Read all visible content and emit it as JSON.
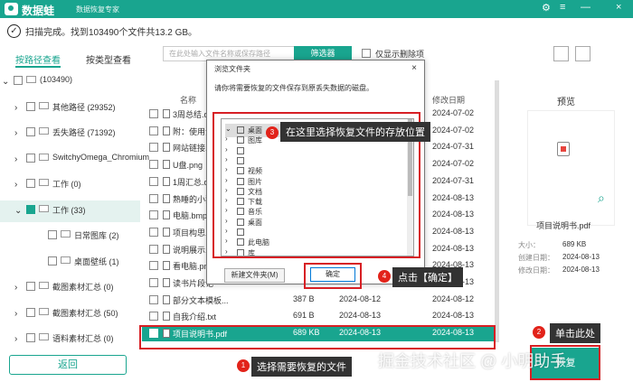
{
  "app": {
    "brand": "数据蛙",
    "subtitle": "数据恢复专家"
  },
  "status": "扫描完成。找到103490个文件共13.2 GB。",
  "search": {
    "placeholder": "在此处输入文件名称或保存路径",
    "filter": "筛选器",
    "only_deleted": "仅显示删除项"
  },
  "tabs": [
    "按路径查看",
    "按类型查看"
  ],
  "tree": [
    {
      "label": "(103490)",
      "level": 0,
      "checked": false
    },
    {
      "label": "其他路径 (29352)",
      "level": 1,
      "checked": false
    },
    {
      "label": "丢失路径 (71392)",
      "level": 1,
      "checked": false
    },
    {
      "label": "SwitchyOmega_Chromium",
      "level": 1,
      "checked": false
    },
    {
      "label": "工作 (0)",
      "level": 1,
      "checked": false
    },
    {
      "label": "工作 (33)",
      "level": 1,
      "checked": true
    },
    {
      "label": "日常图库 (2)",
      "level": 2,
      "checked": false
    },
    {
      "label": "桌面壁纸 (1)",
      "level": 2,
      "checked": false
    },
    {
      "label": "截图素材汇总 (0)",
      "level": 1,
      "checked": false
    },
    {
      "label": "截图素材汇总 (50)",
      "level": 1,
      "checked": false
    },
    {
      "label": "语料素材汇总 (0)",
      "level": 1,
      "checked": false
    }
  ],
  "back": "返回",
  "columns": {
    "name": "名称",
    "modified": "修改日期"
  },
  "files": [
    {
      "name": "3周总结.do",
      "size": "",
      "date": "",
      "modified": "2024-07-02",
      "checked": false
    },
    {
      "name": "附：使用注",
      "size": "",
      "date": "",
      "modified": "2024-07-02",
      "checked": false
    },
    {
      "name": "网站链接.tx",
      "size": "",
      "date": "",
      "modified": "2024-07-31",
      "checked": false
    },
    {
      "name": "U盘.png",
      "size": "",
      "date": "",
      "modified": "2024-07-02",
      "checked": false
    },
    {
      "name": "1周汇总.do",
      "size": "",
      "date": "",
      "modified": "2024-07-31",
      "checked": false
    },
    {
      "name": "熟睡的小猫",
      "size": "",
      "date": "",
      "modified": "2024-08-13",
      "checked": false
    },
    {
      "name": "电脑.bmp",
      "size": "",
      "date": "",
      "modified": "2024-08-13",
      "checked": false
    },
    {
      "name": "项目构思.do",
      "size": "",
      "date": "",
      "modified": "2024-08-13",
      "checked": false
    },
    {
      "name": "说明展示.pn",
      "size": "",
      "date": "",
      "modified": "2024-08-13",
      "checked": false
    },
    {
      "name": "看电脑.png",
      "size": "",
      "date": "",
      "modified": "2024-08-13",
      "checked": false
    },
    {
      "name": "读书片段记",
      "size": "",
      "date": "",
      "modified": "2024-08-13",
      "checked": false
    },
    {
      "name": "部分文本模板...",
      "size": "387 B",
      "date": "2024-08-12",
      "modified": "2024-08-12",
      "checked": false
    },
    {
      "name": "自我介绍.txt",
      "size": "691 B",
      "date": "2024-08-13",
      "modified": "2024-08-13",
      "checked": false
    },
    {
      "name": "项目说明书.pdf",
      "size": "689 KB",
      "date": "2024-08-13",
      "modified": "2024-08-13",
      "checked": true
    }
  ],
  "preview": {
    "title": "预览",
    "name": "项目说明书.pdf",
    "size_label": "大小：",
    "size": "689 KB",
    "created_label": "创建日期：",
    "created": "2024-08-13",
    "modified_label": "修改日期：",
    "modified": "2024-08-13"
  },
  "restore": "恢复",
  "dialog": {
    "title": "浏览文件夹",
    "prompt": "请你将需要恢复的文件保存到原丢失数据的磁盘。",
    "new_folder": "新建文件夹(M)",
    "ok": "确定"
  },
  "dialog_tree": [
    "桌面",
    "图库",
    "",
    "",
    "视频",
    "图片",
    "文档",
    "下载",
    "音乐",
    "桌面",
    "",
    "此电脑",
    "库"
  ],
  "annotations": {
    "a1": "选择需要恢复的文件",
    "a2": "单击此处",
    "a3": "在这里选择恢复文件的存放位置",
    "a4": "点击【确定】",
    "watermark": "掘金技术社区 @ 小明助手"
  },
  "colors": {
    "accent": "#19a58f",
    "red": "#d71f24"
  }
}
